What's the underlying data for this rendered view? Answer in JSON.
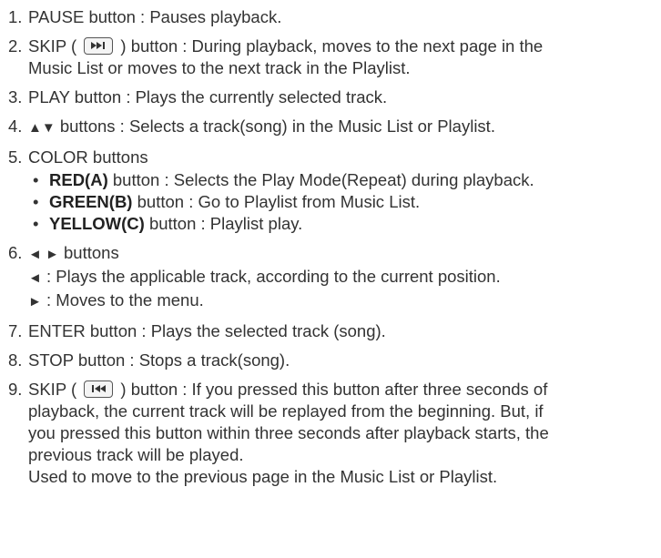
{
  "items": [
    {
      "num": "1.",
      "text": "PAUSE button : Pauses playback."
    },
    {
      "num": "2.",
      "pre": "SKIP (",
      "post": ") button : During playback, moves to the next page in the",
      "line2": "Music List or moves to the next track in the Playlist.",
      "icon": "skip-forward-icon"
    },
    {
      "num": "3.",
      "text": "PLAY button : Plays the currently selected track."
    },
    {
      "num": "4.",
      "arrows": "▲▼",
      "text": " buttons : Selects a track(song) in the Music List or Playlist."
    },
    {
      "num": "5.",
      "text": "COLOR buttons",
      "bullets": [
        {
          "bold": "RED(A)",
          "text": " button : Selects the Play Mode(Repeat) during playback."
        },
        {
          "bold": "GREEN(B)",
          "text": " button : Go to Playlist from Music List."
        },
        {
          "bold": "YELLOW(C)",
          "text": " button : Playlist play."
        }
      ]
    },
    {
      "num": "6.",
      "arrows": "◄ ►",
      "text": " buttons",
      "lines": [
        {
          "arrow": "◄",
          "text": " : Plays the applicable track, according to the current position."
        },
        {
          "arrow": "►",
          "text": " : Moves to the menu."
        }
      ]
    },
    {
      "num": "7.",
      "text": "ENTER button : Plays the selected track (song)."
    },
    {
      "num": "8.",
      "text": "STOP button : Stops a track(song)."
    },
    {
      "num": "9.",
      "pre": "SKIP (",
      "post": ") button : If you pressed this button after three seconds of",
      "icon": "skip-back-icon",
      "cont": [
        "playback, the current track will be replayed from the beginning. But, if",
        "you pressed this button within three seconds after playback starts, the",
        "previous track will be played.",
        "Used to move to the previous page in the Music List or Playlist."
      ]
    }
  ]
}
